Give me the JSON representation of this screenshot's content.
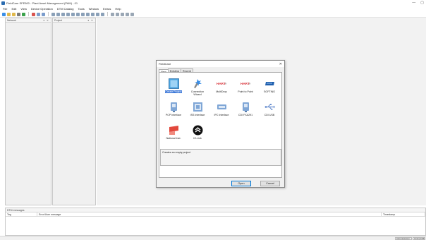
{
  "window": {
    "title": "FieldCare SFE500 - Plant Asset Management (PAM) - 01",
    "controls": [
      "—",
      "▢"
    ]
  },
  "menu": [
    "File",
    "Edit",
    "View",
    "Device Operation",
    "DTM Catalog",
    "Tools",
    "Window",
    "Extras",
    "Help"
  ],
  "toolbar": {
    "buttons": [
      {
        "icon": "new-icon",
        "color": "#3a8ee6"
      },
      {
        "icon": "open-icon",
        "color": "#e0b84a"
      },
      {
        "icon": "save-icon",
        "color": "#e0b84a"
      },
      {
        "icon": "print-icon",
        "color": "#7a7a7a"
      },
      {
        "icon": "connect-icon",
        "color": "#3aa24a"
      },
      {
        "icon": "disconnect-icon",
        "color": "#d9534f"
      },
      {
        "icon": "refresh-icon",
        "color": "#7a9ccc"
      },
      {
        "icon": "scan-icon",
        "color": "#7a9ccc"
      },
      {
        "icon": "device-icon",
        "color": "#8aa0b8"
      },
      {
        "icon": "device-icon",
        "color": "#8aa0b8"
      },
      {
        "icon": "device-icon",
        "color": "#8aa0b8"
      },
      {
        "icon": "device-icon",
        "color": "#8aa0b8"
      },
      {
        "icon": "device-icon",
        "color": "#8aa0b8"
      },
      {
        "icon": "device-icon",
        "color": "#8aa0b8"
      },
      {
        "icon": "device-icon",
        "color": "#8aa0b8"
      },
      {
        "icon": "device-icon",
        "color": "#8aa0b8"
      },
      {
        "icon": "device-icon",
        "color": "#8aa0b8"
      },
      {
        "icon": "device-icon",
        "color": "#8aa0b8"
      },
      {
        "icon": "device-icon",
        "color": "#8aa0b8"
      },
      {
        "icon": "layout-icon",
        "color": "#9aa7b5"
      },
      {
        "icon": "layout-icon",
        "color": "#9aa7b5"
      },
      {
        "icon": "layout-icon",
        "color": "#9aa7b5"
      },
      {
        "icon": "layout-icon",
        "color": "#9aa7b5"
      },
      {
        "icon": "layout-icon",
        "color": "#9aa7b5"
      }
    ]
  },
  "panes": {
    "network": {
      "title": "Network",
      "tools": "▾ ✕"
    },
    "project": {
      "title": "Project",
      "tools": "▾ ✕"
    }
  },
  "dialog": {
    "title": "FieldCare",
    "close": "✕",
    "tabs": [
      {
        "label": "New",
        "active": true
      },
      {
        "label": "Existing",
        "active": false
      },
      {
        "label": "Recent",
        "active": false
      }
    ],
    "items": [
      {
        "label": "Create Project",
        "icon": "create-project-icon",
        "color": "#4aa3df",
        "selected": true
      },
      {
        "label": "Connection Wizard",
        "icon": "connection-wizard-icon",
        "color": "#3a8ee6",
        "selected": false
      },
      {
        "label": "MultiDrop",
        "icon": "hart-multidrop-icon",
        "color": "#d7282f",
        "selected": false
      },
      {
        "label": "Point to Point",
        "icon": "hart-point-to-point-icon",
        "color": "#d7282f",
        "selected": false
      },
      {
        "label": "SOFTING",
        "icon": "softing-icon",
        "color": "#1f5fae",
        "selected": false
      },
      {
        "label": "PCP Interface",
        "icon": "pcp-interface-icon",
        "color": "#7fa6d6",
        "selected": false
      },
      {
        "label": "ISS Interface",
        "icon": "iss-interface-icon",
        "color": "#7fa6d6",
        "selected": false
      },
      {
        "label": "IPC Interface",
        "icon": "ipc-interface-icon",
        "color": "#7fa6d6",
        "selected": false
      },
      {
        "label": "CDI FXA291",
        "icon": "cdi-fxa291-icon",
        "color": "#7fa6d6",
        "selected": false
      },
      {
        "label": "CDI USB",
        "icon": "cdi-usb-icon",
        "color": "#6a8fcf",
        "selected": false
      },
      {
        "label": "National Inst.",
        "icon": "national-instruments-icon",
        "color": "#e2483c",
        "selected": false
      },
      {
        "label": "IO-Link",
        "icon": "io-link-icon",
        "color": "#111111",
        "selected": false
      }
    ],
    "description": "Creates an empty project",
    "buttons": {
      "open": "Open",
      "cancel": "Cancel"
    }
  },
  "messages": {
    "title": "DTM messages",
    "columns": {
      "tag": "Tag",
      "message": "Error/User message",
      "timestamp": "Timestamp"
    }
  },
  "statusbar": {
    "cells": [
      "Administration",
      "Online/Offline"
    ]
  }
}
